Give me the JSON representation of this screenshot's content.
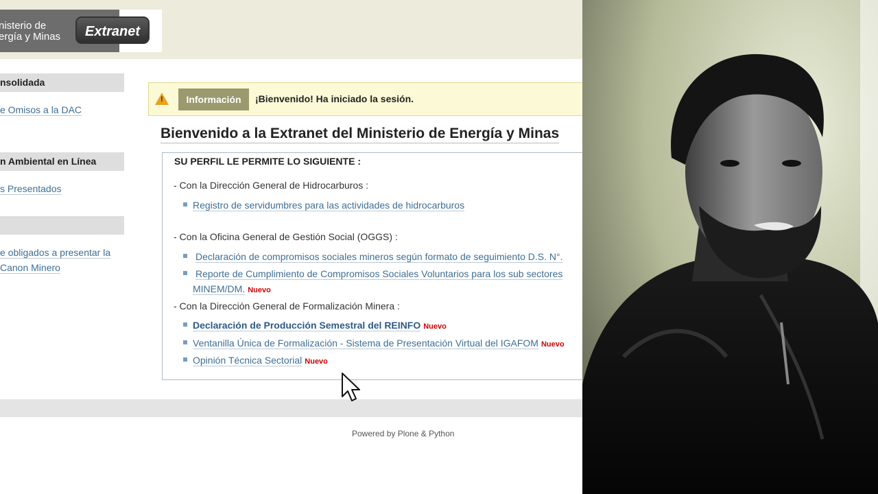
{
  "header": {
    "logo_text_line1": "nisterio de",
    "logo_text_line2": "ergía y Minas",
    "badge": "Extranet"
  },
  "sidebar": {
    "sections": [
      {
        "title": "nsolidada",
        "links": [
          "e Omisos a la DAC"
        ]
      },
      {
        "title": "n Ambiental en Línea",
        "links": [
          "s Presentados"
        ]
      },
      {
        "title": "",
        "links": [
          "e obligados a presentar la",
          "Canon Minero"
        ]
      }
    ]
  },
  "info": {
    "label": "Información",
    "message": "¡Bienvenido! Ha iniciado la sesión."
  },
  "main": {
    "title": "Bienvenido a la Extranet del Ministerio de Energía y Minas",
    "perfil_title": "SU PERFIL LE PERMITE LO SIGUIENTE :",
    "groups": [
      {
        "heading": "- Con la Dirección General de Hidrocarburos :",
        "items": [
          "Registro de servidumbres para las actividades de hidrocarburos"
        ]
      },
      {
        "heading": "- Con la Oficina General de Gestión Social (OGGS) :",
        "items": [
          "Declaración de compromisos sociales mineros según formato de seguimiento D.S. N°.",
          "Reporte de Cumplimiento de Compromisos Sociales Voluntarios para los sub sectores",
          "MINEM/DM."
        ]
      },
      {
        "heading": "- Con la Dirección General de Formalización Minera :",
        "items": [
          "Declaración de Producción Semestral del REINFO",
          "Ventanilla Única de Formalización - Sistema de Presentación Virtual del IGAFOM",
          "Opinión Técnica Sectorial"
        ]
      }
    ],
    "new_badge": "Nuevo"
  },
  "footer": {
    "text": "Powered by Plone & Python"
  },
  "colors": {
    "header_bg": "#ecebdc",
    "link": "#3f6e94",
    "info_bg": "#fbf9d6",
    "info_label_bg": "#9a9a6e",
    "new_badge": "#cc0000"
  },
  "icons": [
    "warning-icon",
    "mouse-cursor-icon"
  ]
}
